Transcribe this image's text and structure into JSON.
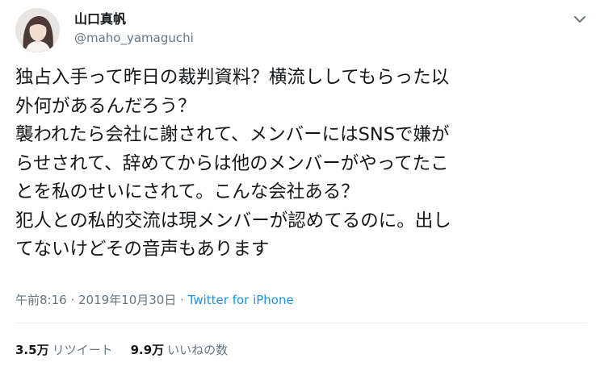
{
  "user": {
    "display_name": "山口真帆",
    "handle": "@maho_yamaguchi"
  },
  "menu_icon": "chevron-down-icon",
  "tweet": {
    "lines": [
      "独占入手って昨日の裁判資料？横流ししてもらった以",
      "外何があるんだろう？",
      "襲われたら会社に謝されて、メンバーにはSNSで嫌が",
      "らせされて、辞めてからは他のメンバーがやってたこ",
      "とを私のせいにされて。こんな会社ある？",
      "犯人との私的交流は現メンバーが認めてるのに。出し",
      "てないけどその音声もあります"
    ]
  },
  "meta": {
    "timestamp": "午前8:16 · 2019年10月30日 · ",
    "source": "Twitter for iPhone"
  },
  "stats": {
    "retweets_count": "3.5万",
    "retweets_label": "リツイート",
    "likes_count": "9.9万",
    "likes_label": "いいねの数"
  },
  "colors": {
    "text_primary": "#14171a",
    "text_secondary": "#657786",
    "link": "#1b95e0",
    "divider": "#e6ecf0"
  }
}
